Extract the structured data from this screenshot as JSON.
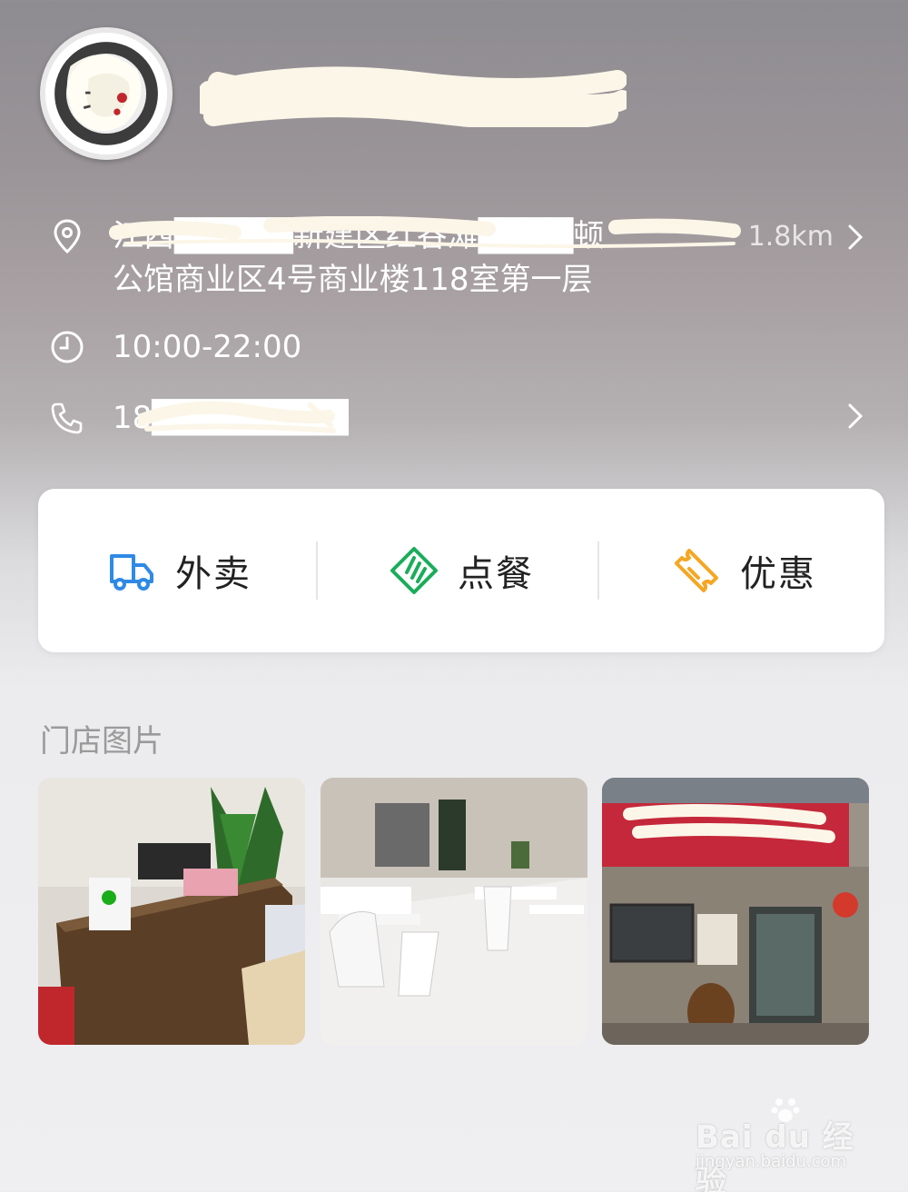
{
  "shop": {
    "name": "████████",
    "address_line1": "江西█████新建区红谷滩████顿",
    "address_line2": "公馆商业区4号商业楼118室第一层",
    "distance": "1.8km",
    "hours": "10:00-22:00",
    "phone": "18█████████"
  },
  "actions": [
    {
      "label": "外卖",
      "icon": "delivery-truck-icon",
      "color": "#2f8ae5"
    },
    {
      "label": "点餐",
      "icon": "order-ticket-icon",
      "color": "#1aad5a"
    },
    {
      "label": "优惠",
      "icon": "coupon-icon",
      "color": "#f5a623"
    }
  ],
  "photos_section": {
    "title": "门店图片"
  },
  "watermark": {
    "main": "Bai du 经验",
    "sub": "jingyan.baidu.com"
  }
}
